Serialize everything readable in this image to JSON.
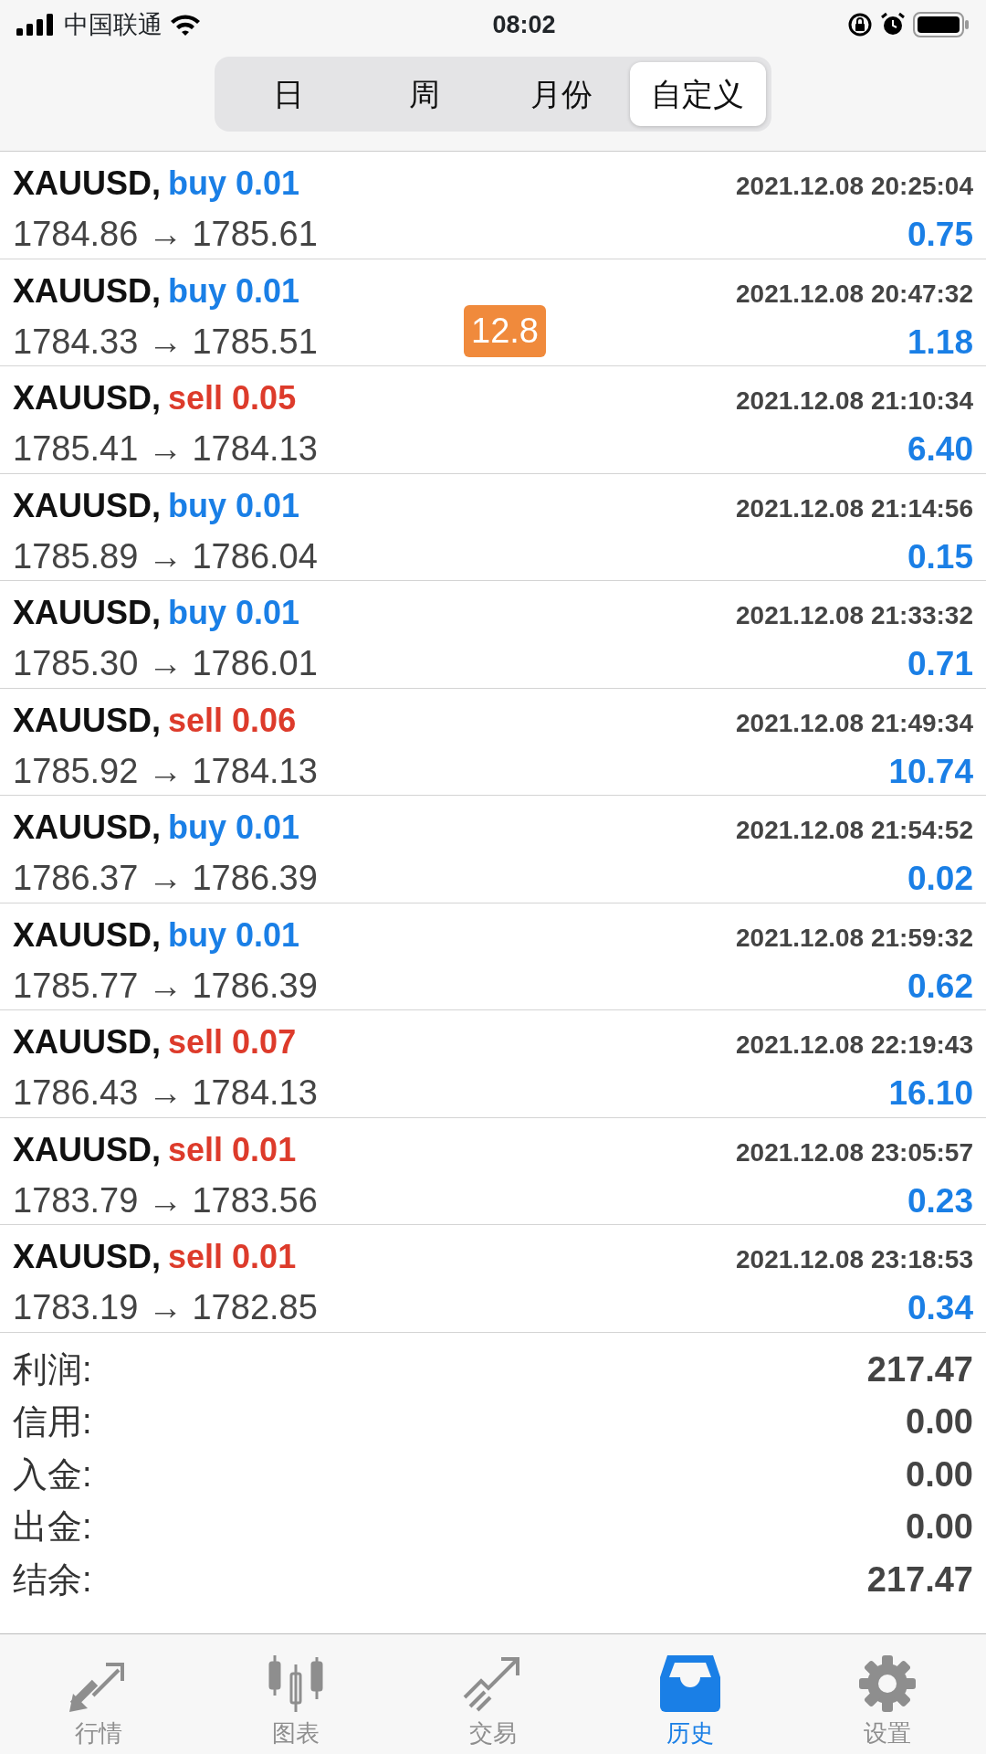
{
  "status_bar": {
    "carrier": "中国联通",
    "time": "08:02"
  },
  "segments": [
    {
      "label": "日",
      "selected": false
    },
    {
      "label": "周",
      "selected": false
    },
    {
      "label": "月份",
      "selected": false
    },
    {
      "label": "自定义",
      "selected": true
    }
  ],
  "trades": [
    {
      "symbol": "XAUUSD,",
      "side": "buy",
      "volume": "0.01",
      "time": "2021.12.08 20:25:04",
      "prices": "1784.86 → 1785.61",
      "profit": "0.75"
    },
    {
      "symbol": "XAUUSD,",
      "side": "buy",
      "volume": "0.01",
      "time": "2021.12.08 20:47:32",
      "prices": "1784.33 → 1785.51",
      "profit": "1.18",
      "overlay": "12.8"
    },
    {
      "symbol": "XAUUSD,",
      "side": "sell",
      "volume": "0.05",
      "time": "2021.12.08 21:10:34",
      "prices": "1785.41 → 1784.13",
      "profit": "6.40"
    },
    {
      "symbol": "XAUUSD,",
      "side": "buy",
      "volume": "0.01",
      "time": "2021.12.08 21:14:56",
      "prices": "1785.89 → 1786.04",
      "profit": "0.15"
    },
    {
      "symbol": "XAUUSD,",
      "side": "buy",
      "volume": "0.01",
      "time": "2021.12.08 21:33:32",
      "prices": "1785.30 → 1786.01",
      "profit": "0.71"
    },
    {
      "symbol": "XAUUSD,",
      "side": "sell",
      "volume": "0.06",
      "time": "2021.12.08 21:49:34",
      "prices": "1785.92 → 1784.13",
      "profit": "10.74"
    },
    {
      "symbol": "XAUUSD,",
      "side": "buy",
      "volume": "0.01",
      "time": "2021.12.08 21:54:52",
      "prices": "1786.37 → 1786.39",
      "profit": "0.02"
    },
    {
      "symbol": "XAUUSD,",
      "side": "buy",
      "volume": "0.01",
      "time": "2021.12.08 21:59:32",
      "prices": "1785.77 → 1786.39",
      "profit": "0.62"
    },
    {
      "symbol": "XAUUSD,",
      "side": "sell",
      "volume": "0.07",
      "time": "2021.12.08 22:19:43",
      "prices": "1786.43 → 1784.13",
      "profit": "16.10"
    },
    {
      "symbol": "XAUUSD,",
      "side": "sell",
      "volume": "0.01",
      "time": "2021.12.08 23:05:57",
      "prices": "1783.79 → 1783.56",
      "profit": "0.23"
    },
    {
      "symbol": "XAUUSD,",
      "side": "sell",
      "volume": "0.01",
      "time": "2021.12.08 23:18:53",
      "prices": "1783.19 → 1782.85",
      "profit": "0.34"
    }
  ],
  "summary": [
    {
      "label": "利润:",
      "value": "217.47"
    },
    {
      "label": "信用:",
      "value": "0.00"
    },
    {
      "label": "入金:",
      "value": "0.00"
    },
    {
      "label": "出金:",
      "value": "0.00"
    },
    {
      "label": "结余:",
      "value": "217.47"
    }
  ],
  "tab_bar": [
    {
      "label": "行情",
      "kind": "quotes",
      "selected": false
    },
    {
      "label": "图表",
      "kind": "chart",
      "selected": false
    },
    {
      "label": "交易",
      "kind": "trade",
      "selected": false
    },
    {
      "label": "历史",
      "kind": "history",
      "selected": true
    },
    {
      "label": "设置",
      "kind": "settings",
      "selected": false
    }
  ]
}
